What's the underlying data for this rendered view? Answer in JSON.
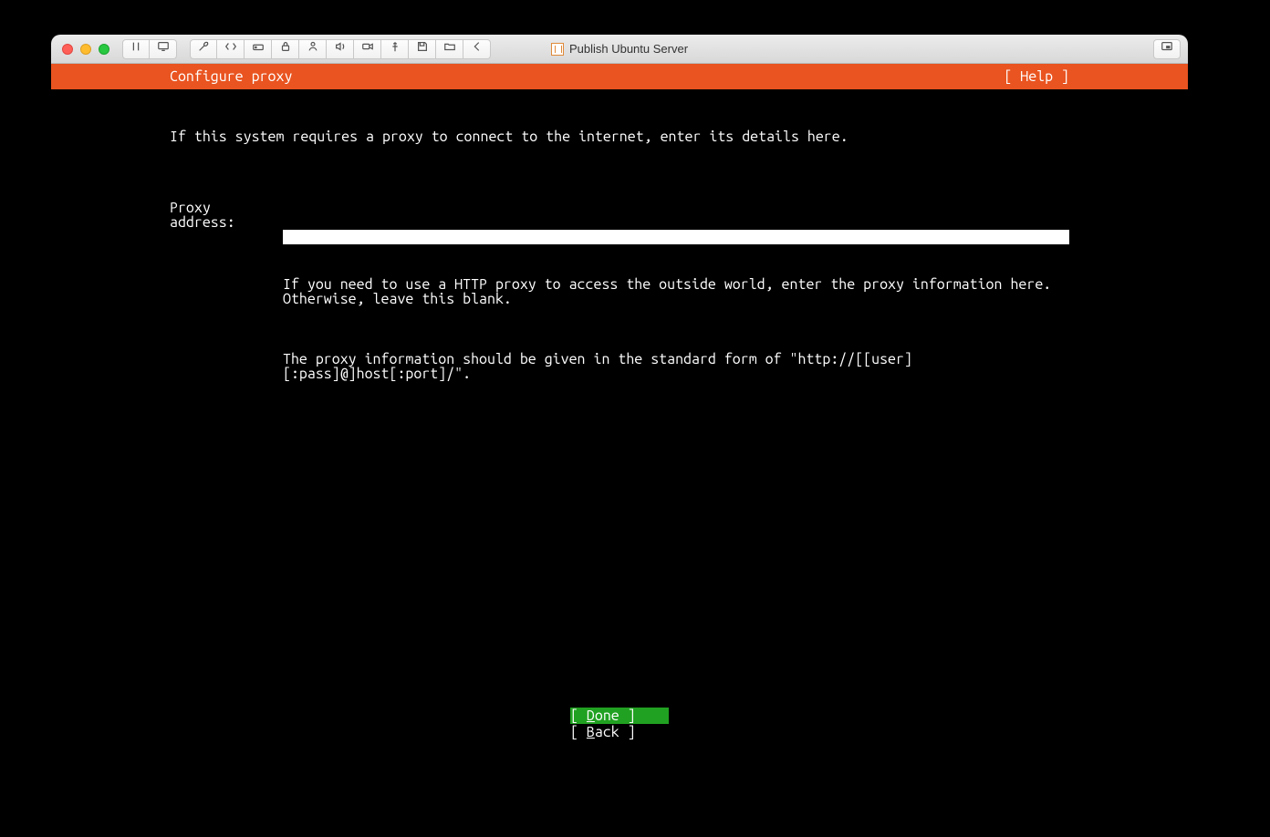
{
  "window": {
    "title": "Publish Ubuntu Server"
  },
  "toolbar": {
    "icons": [
      "pause-icon",
      "display-settings-icon",
      "wrench-icon",
      "code-icon",
      "hdd-icon",
      "lock-icon",
      "person-icon",
      "sound-icon",
      "camera-icon",
      "usb-icon",
      "floppy-icon",
      "folder-share-icon",
      "chevron-left-icon"
    ]
  },
  "tui": {
    "header_left": "Configure proxy",
    "header_right": "[ Help ]",
    "intro": "If this system requires a proxy to connect to the internet, enter its details here.",
    "proxy_label": "Proxy address:",
    "proxy_value": "",
    "hint1": "If you need to use a HTTP proxy to access the outside world, enter the proxy information here. Otherwise, leave this blank.",
    "hint2": "The proxy information should be given in the standard form of \"http://[[user][:pass]@]host[:port]/\".",
    "done_open": "[ ",
    "done_letter": "D",
    "done_rest": "one",
    "done_close": "       ]",
    "back_open": "[ ",
    "back_letter": "B",
    "back_rest": "ack",
    "back_close": "       ]"
  }
}
